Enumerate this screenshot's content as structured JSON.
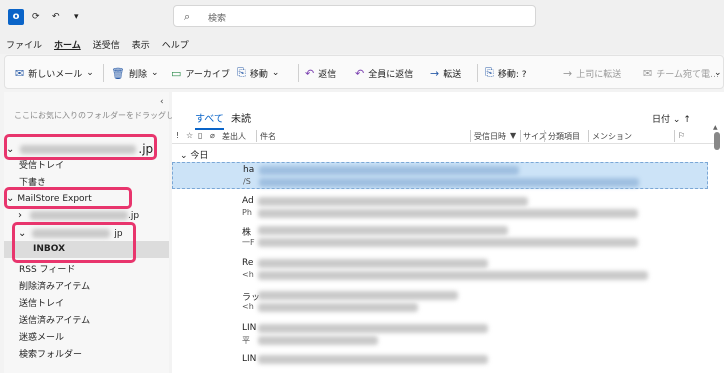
{
  "window": {
    "search_placeholder": "検索"
  },
  "menu": [
    "ファイル",
    "ホーム",
    "送受信",
    "表示",
    "ヘルプ"
  ],
  "ribbon": {
    "new_mail": "新しいメール",
    "delete": "削除",
    "archive": "アーカイブ",
    "move": "移動",
    "reply": "返信",
    "reply_all": "全員に返信",
    "forward": "転送",
    "move_to": "移動: ?",
    "to_manager": "上司に転送",
    "team_mail": "チーム宛て電…"
  },
  "sidebar": {
    "favorites_hint": "ここにお気に入りのフォルダーをドラッグします",
    "account1_suffix": ".jp",
    "account1_folders": [
      "受信トレイ",
      "下書き"
    ],
    "mailstore": "MailStore Export",
    "mailstore_sub_suffix": ".jp",
    "account2_suffix": "jp",
    "inbox": "INBOX",
    "account2_folders": [
      "RSS フィード",
      "削除済みアイテム",
      "送信トレイ",
      "送信済みアイテム",
      "迷惑メール",
      "検索フォルダー"
    ]
  },
  "list": {
    "tabs": [
      "すべて",
      "未読"
    ],
    "sort_label": "日付",
    "columns": [
      "差出人",
      "件名",
      "受信日時",
      "サイズ",
      "分類項目",
      "メンション"
    ],
    "group": "今日",
    "messages": [
      {
        "from": "ha",
        "preview": "/S"
      },
      {
        "from": "Ad",
        "preview": "Ph"
      },
      {
        "from": "株",
        "preview": "一F"
      },
      {
        "from": "Re",
        "preview": "<h"
      },
      {
        "from": "ラッ",
        "preview": "<h"
      },
      {
        "from": "LIN",
        "preview": "平"
      },
      {
        "from": "LIN",
        "preview": ""
      }
    ]
  }
}
